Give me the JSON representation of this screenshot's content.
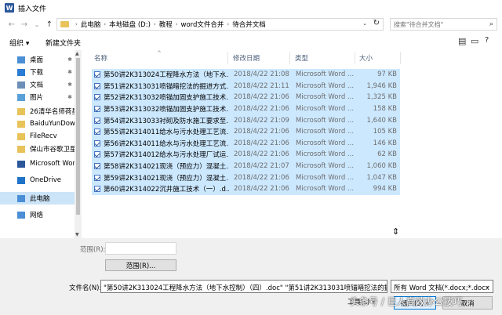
{
  "window": {
    "title": "插入文件",
    "app_icon_letter": "W"
  },
  "nav": {
    "back": "←",
    "forward": "→",
    "recent": "⌄",
    "up": "↑",
    "breadcrumbs": [
      "此电脑",
      "本地磁盘 (D:)",
      "教程",
      "word文件合并",
      "待合并文档"
    ],
    "search_placeholder": "搜索\"待合并文档\""
  },
  "toolbar": {
    "organize": "组织 ▾",
    "new_folder": "新建文件夹"
  },
  "sidebar": {
    "items": [
      {
        "label": "桌面",
        "icon": "desktop-icon",
        "color": "#4a8fd6",
        "pinned": true
      },
      {
        "label": "下载",
        "icon": "download-icon",
        "color": "#2b7cd3",
        "pinned": true
      },
      {
        "label": "文档",
        "icon": "documents-icon",
        "color": "#6d8fb7",
        "pinned": true
      },
      {
        "label": "图片",
        "icon": "pictures-icon",
        "color": "#5aa0d8",
        "pinned": true
      },
      {
        "label": "26清华名师荷星",
        "icon": "folder-icon",
        "color": "#e8c35a",
        "pinned": false
      },
      {
        "label": "BaiduYunDown",
        "icon": "folder-icon",
        "color": "#e8c35a",
        "pinned": false
      },
      {
        "label": "FileRecv",
        "icon": "folder-icon",
        "color": "#e8c35a",
        "pinned": false
      },
      {
        "label": "保山市谷歌卫星",
        "icon": "folder-icon",
        "color": "#e8c35a",
        "pinned": false
      },
      {
        "label": "Microsoft Word",
        "icon": "word-icon",
        "color": "#2b579a",
        "pinned": false
      },
      {
        "label": "OneDrive",
        "icon": "onedrive-icon",
        "color": "#1e73c8",
        "pinned": false
      },
      {
        "label": "此电脑",
        "icon": "computer-icon",
        "color": "#4a8fd6",
        "pinned": false,
        "selected": true
      },
      {
        "label": "网络",
        "icon": "network-icon",
        "color": "#4a8fd6",
        "pinned": false
      }
    ]
  },
  "columns": {
    "name": "名称",
    "date": "修改日期",
    "type": "类型",
    "size": "大小"
  },
  "files": [
    {
      "name": "第50讲2K313024工程降水方法（地下水...",
      "date": "2018/4/22 21:08",
      "type": "Microsoft Word ...",
      "size": "97 KB"
    },
    {
      "name": "第51讲2K313031喷锚暗挖法的掘进方式...",
      "date": "2018/4/22 21:11",
      "type": "Microsoft Word ...",
      "size": "1,946 KB"
    },
    {
      "name": "第52讲2K313032喷锚加固支护施工技术...",
      "date": "2018/4/22 21:06",
      "type": "Microsoft Word ...",
      "size": "1,325 KB"
    },
    {
      "name": "第53讲2K313032喷锚加固支护施工技术...",
      "date": "2018/4/22 21:06",
      "type": "Microsoft Word ...",
      "size": "158 KB"
    },
    {
      "name": "第54讲2K313033衬砌及防水施工要求至...",
      "date": "2018/4/22 21:09",
      "type": "Microsoft Word ...",
      "size": "1,640 KB"
    },
    {
      "name": "第55讲2K314011给水与污水处理工艺流...",
      "date": "2018/4/22 21:06",
      "type": "Microsoft Word ...",
      "size": "105 KB"
    },
    {
      "name": "第56讲2K314011给水与污水处理工艺流...",
      "date": "2018/4/22 21:06",
      "type": "Microsoft Word ...",
      "size": "146 KB"
    },
    {
      "name": "第57讲2K314012给水与污水处理厂试运...",
      "date": "2018/4/22 21:06",
      "type": "Microsoft Word ...",
      "size": "62 KB"
    },
    {
      "name": "第58讲2K314021现浇（预应力）混凝土...",
      "date": "2018/4/22 21:07",
      "type": "Microsoft Word ...",
      "size": "1,060 KB"
    },
    {
      "name": "第59讲2K314021现浇（预应力）混凝土...",
      "date": "2018/4/22 21:06",
      "type": "Microsoft Word ...",
      "size": "1,047 KB"
    },
    {
      "name": "第60讲2K314022沉井施工技术（一）.d...",
      "date": "2018/4/22 21:06",
      "type": "Microsoft Word ...",
      "size": "994 KB"
    }
  ],
  "bottom": {
    "range_label": "范围(R):",
    "range_button": "范围(R)...",
    "filename_label": "文件名(N):",
    "filename_value": "\"第50讲2K313024工程降水方法（地下水控制）（四）.doc\" \"第51讲2K313031喷锚暗挖法的掘",
    "filetype_value": "所有 Word 文档(*.docx;*.docx",
    "tools": "工具(L) ▾",
    "open": "插入(S) ▾",
    "cancel": "取消"
  },
  "watermark": "头条号 / 巨人高效办公技巧"
}
